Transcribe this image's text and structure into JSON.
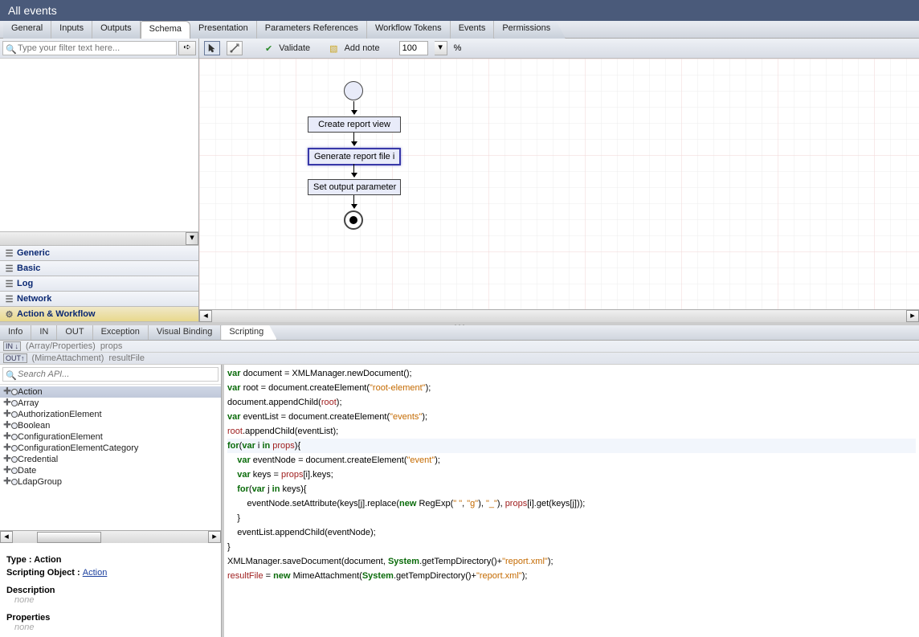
{
  "title": "All events",
  "tabs": {
    "top": [
      "General",
      "Inputs",
      "Outputs",
      "Schema",
      "Presentation",
      "Parameters References",
      "Workflow Tokens",
      "Events",
      "Permissions"
    ],
    "top_active": 3,
    "bottom": [
      "Info",
      "IN",
      "OUT",
      "Exception",
      "Visual Binding",
      "Scripting"
    ],
    "bottom_active": 5
  },
  "filter": {
    "placeholder": "Type your filter text here..."
  },
  "accordion": [
    "Generic",
    "Basic",
    "Log",
    "Network",
    "Action & Workflow"
  ],
  "toolbar": {
    "validate": "Validate",
    "addnote": "Add note",
    "zoom": "100",
    "zoom_suffix": "%"
  },
  "flow": {
    "n1": "Create report view",
    "n2": "Generate report file i",
    "n3": "Set output parameter"
  },
  "vars": [
    {
      "badge": "IN ↓",
      "type": "(Array/Properties)",
      "name": "props"
    },
    {
      "badge": "OUT↑",
      "type": "(MimeAttachment)",
      "name": "resultFile"
    }
  ],
  "api": {
    "search_placeholder": "Search API...",
    "items": [
      "Action",
      "Array",
      "AuthorizationElement",
      "Boolean",
      "ConfigurationElement",
      "ConfigurationElementCategory",
      "Credential",
      "Date",
      "LdapGroup"
    ],
    "selected": 0
  },
  "info": {
    "type_label": "Type : ",
    "type_value": "Action",
    "so_label": "Scripting Object : ",
    "so_value": "Action",
    "desc_label": "Description",
    "props_label": "Properties",
    "none": "none"
  },
  "code": {
    "l1a": "var",
    "l1b": " document = XMLManager.newDocument();",
    "l2a": "var",
    "l2b": " root = document.createElement(",
    "l2c": "\"root-element\"",
    "l2d": ");",
    "l3": "document.appendChild(",
    "l3b": "root",
    "l3c": ");",
    "l4a": "var",
    "l4b": " eventList = document.createElement(",
    "l4c": "\"events\"",
    "l4d": ");",
    "l5a": "root",
    "l5b": ".appendChild(eventList);",
    "l6a": "for",
    "l6b": "(",
    "l6c": "var",
    "l6d": " i ",
    "l6e": "in",
    "l6f": " props",
    "l6g": "){",
    "l7a": "    var",
    "l7b": " eventNode = document.createElement(",
    "l7c": "\"event\"",
    "l7d": ");",
    "l8a": "    var",
    "l8b": " keys = ",
    "l8c": "props",
    "l8d": "[i].keys;",
    "l9a": "    for",
    "l9b": "(",
    "l9c": "var",
    "l9d": " j ",
    "l9e": "in",
    "l9f": " keys){",
    "l10a": "        eventNode.setAttribute(keys[j].replace(",
    "l10b": "new",
    "l10c": " RegExp(",
    "l10d": "\" \"",
    "l10e": ", ",
    "l10f": "\"g\"",
    "l10g": "), ",
    "l10h": "\"_\"",
    "l10i": "), ",
    "l10j": "props",
    "l10k": "[i].get(keys[j]));",
    "l11": "    }",
    "l12": "    eventList.appendChild(eventNode);",
    "l13": "}",
    "l14a": "XMLManager.saveDocument(document, ",
    "l14b": "System",
    "l14c": ".getTempDirectory()+",
    "l14d": "\"report.xml\"",
    "l14e": ");",
    "l15a": "resultFile",
    "l15b": " = ",
    "l15c": "new",
    "l15d": " MimeAttachment(",
    "l15e": "System",
    "l15f": ".getTempDirectory()+",
    "l15g": "\"report.xml\"",
    "l15h": ");"
  }
}
